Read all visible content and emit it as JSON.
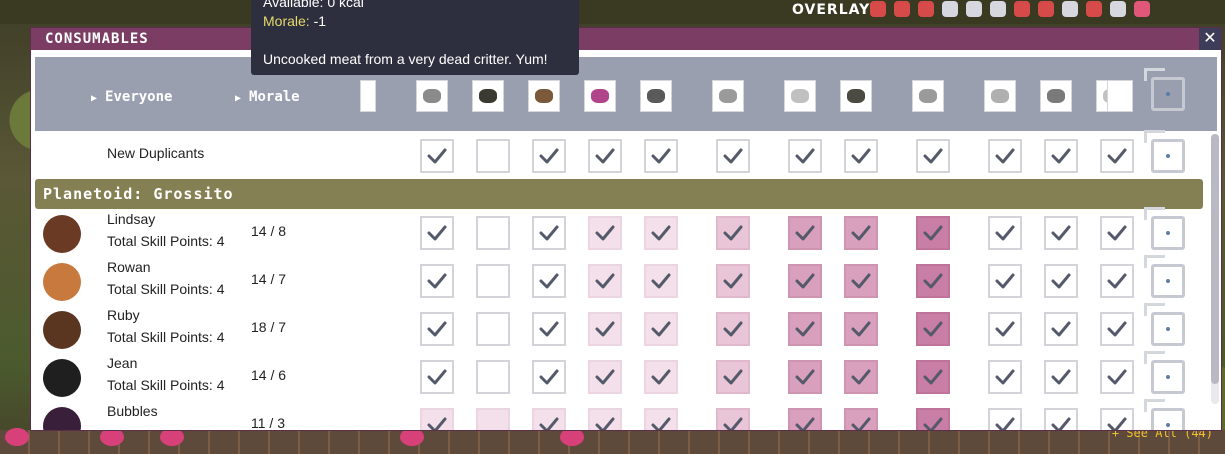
{
  "topbar": {
    "overlays_label": "OVERLAYS",
    "see_all": "+ See All (44)"
  },
  "panel": {
    "title": "CONSUMABLES",
    "close_label": "✕",
    "header": {
      "everyone_label": "Everyone",
      "morale_label": "Morale"
    },
    "new_duplicants_label": "New Duplicants",
    "planetoid_label": "Planetoid: Grossito",
    "duplicants": [
      {
        "name": "Lindsay",
        "skill": "Total Skill Points: 4",
        "morale": "14 / 8"
      },
      {
        "name": "Rowan",
        "skill": "Total Skill Points: 4",
        "morale": "14 / 7"
      },
      {
        "name": "Ruby",
        "skill": "Total Skill Points: 4",
        "morale": "18 / 7"
      },
      {
        "name": "Jean",
        "skill": "Total Skill Points: 4",
        "morale": "14 / 6"
      },
      {
        "name": "Bubbles",
        "skill": "",
        "morale": "11 / 3"
      }
    ]
  },
  "tooltip": {
    "available": "Available: 0 kcal",
    "morale_key": "Morale:",
    "morale_value": " -1",
    "description": "Uncooked meat from a very dead critter. Yum!"
  },
  "colors": {
    "title_bar": "#7b3d64",
    "planetoid_bar": "#858054",
    "header": "#9a9fb0"
  }
}
